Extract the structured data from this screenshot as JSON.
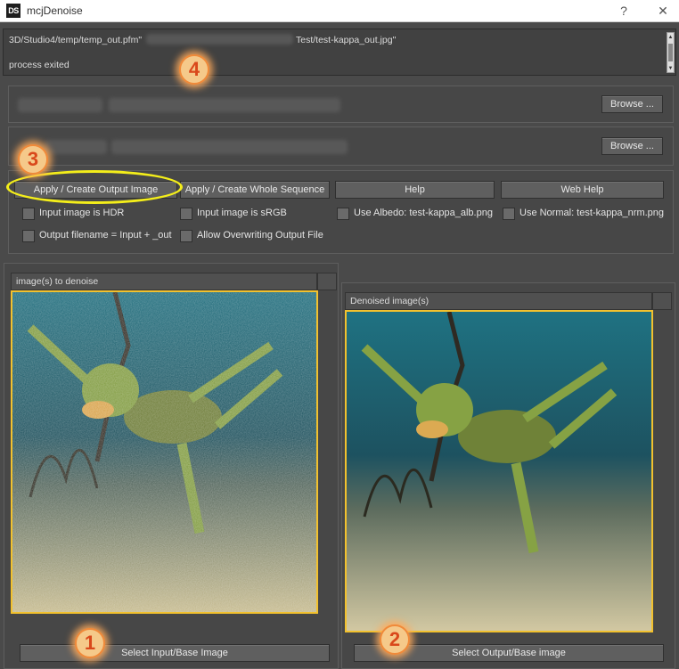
{
  "window": {
    "icon_label": "DS",
    "title": "mcjDenoise",
    "help_glyph": "?",
    "close_glyph": "✕"
  },
  "log": {
    "line1_a": "3D/Studio4/temp/temp_out.pfm\"",
    "line1_b": "Test/test-kappa_out.jpg\"",
    "line2": "process exited"
  },
  "files": {
    "browse_input_label": "Browse ...",
    "browse_output_label": "Browse ..."
  },
  "actions": {
    "apply_output": "Apply / Create Output Image",
    "apply_sequence": "Apply / Create Whole Sequence",
    "help": "Help",
    "web_help": "Web Help"
  },
  "options": {
    "hdr": "Input image is HDR",
    "srgb": "Input image is sRGB",
    "albedo": "Use Albedo: test-kappa_alb.png",
    "normal": "Use Normal: test-kappa_nrm.png",
    "output_filename": "Output filename = Input + _out",
    "allow_overwrite": "Allow Overwriting Output File"
  },
  "views": {
    "input_title": "image(s) to denoise",
    "output_title": "Denoised image(s)",
    "select_input": "Select Input/Base Image",
    "select_output": "Select Output/Base image"
  },
  "annotations": {
    "step1": "1",
    "step2": "2",
    "step3": "3",
    "step4": "4"
  },
  "colors": {
    "frame_accent": "#f2c12e",
    "badge_fill": "#f5c98a",
    "badge_text": "#d9481b",
    "ellipse": "#f4ee1a"
  },
  "icons": [
    "help-icon",
    "close-icon",
    "scroll-up-icon",
    "scroll-down-icon"
  ]
}
